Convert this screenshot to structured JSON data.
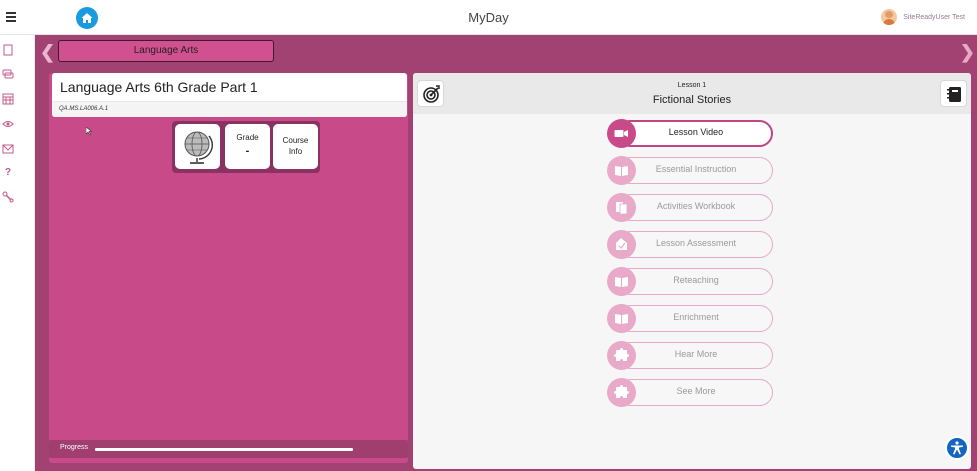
{
  "app": {
    "title": "MyDay"
  },
  "user": {
    "name": "SiteReadyUser Test"
  },
  "subject": {
    "label": "Language Arts"
  },
  "course": {
    "title": "Language Arts 6th Grade Part 1",
    "code": "QA.MS.LA006.A.1",
    "tiles": {
      "grade_label": "Grade",
      "grade_value": "-",
      "info_label_1": "Course",
      "info_label_2": "Info"
    },
    "progress": {
      "label": "Progress",
      "fraction": 1.0
    }
  },
  "lesson": {
    "number_label": "Lesson 1",
    "title": "Fictional Stories",
    "resources": [
      {
        "label": "Lesson Video",
        "icon": "video-icon",
        "active": true
      },
      {
        "label": "Essential Instruction",
        "icon": "book-open-icon",
        "active": false
      },
      {
        "label": "Activities Workbook",
        "icon": "workbook-icon",
        "active": false
      },
      {
        "label": "Lesson Assessment",
        "icon": "assessment-icon",
        "active": false
      },
      {
        "label": "Reteaching",
        "icon": "book-open-icon",
        "active": false
      },
      {
        "label": "Enrichment",
        "icon": "book-open-icon",
        "active": false
      },
      {
        "label": "Hear More",
        "icon": "puzzle-icon",
        "active": false
      },
      {
        "label": "See More",
        "icon": "puzzle-icon",
        "active": false
      }
    ]
  },
  "colors": {
    "brand": "#a24273",
    "panel": "#c94a89",
    "home": "#1a9be0",
    "accessibility": "#1565c0"
  }
}
